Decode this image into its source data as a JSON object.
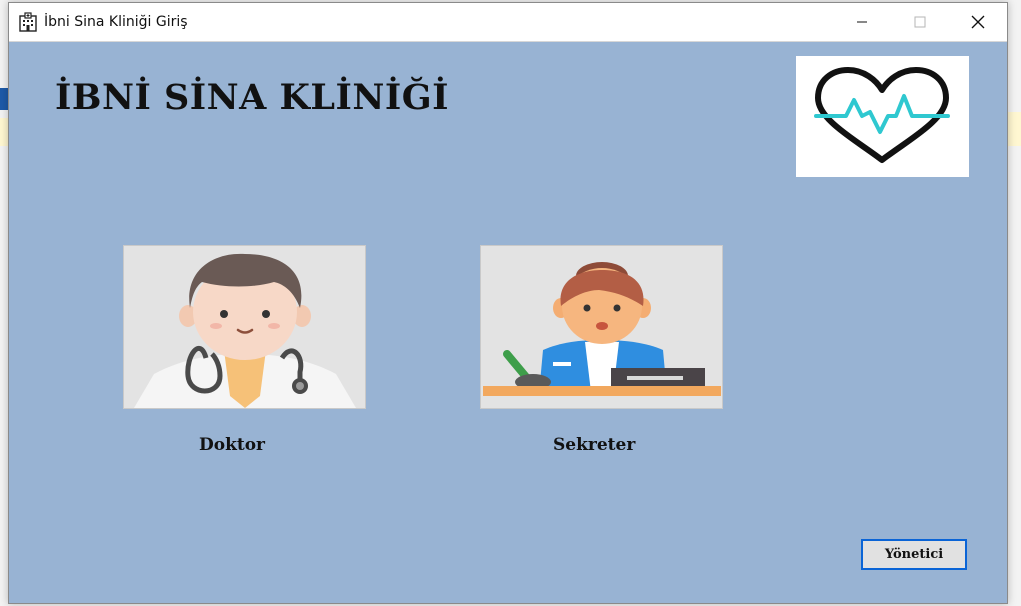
{
  "window": {
    "title": "İbni Sina Kliniği Giriş",
    "controls": [
      "minimize",
      "maximize",
      "close"
    ]
  },
  "main": {
    "clinic_title": "İBNİ SİNA KLİNİĞİ",
    "logo_icon": "heart-pulse-icon",
    "roles": [
      {
        "label": "Doktor",
        "image": "doctor-avatar"
      },
      {
        "label": "Sekreter",
        "image": "secretary-avatar"
      }
    ],
    "admin_button_label": "Yönetici"
  },
  "colors": {
    "window_background": "#98b3d3",
    "accent": "#0a64d6",
    "logo_pulse": "#2fc8d0"
  }
}
